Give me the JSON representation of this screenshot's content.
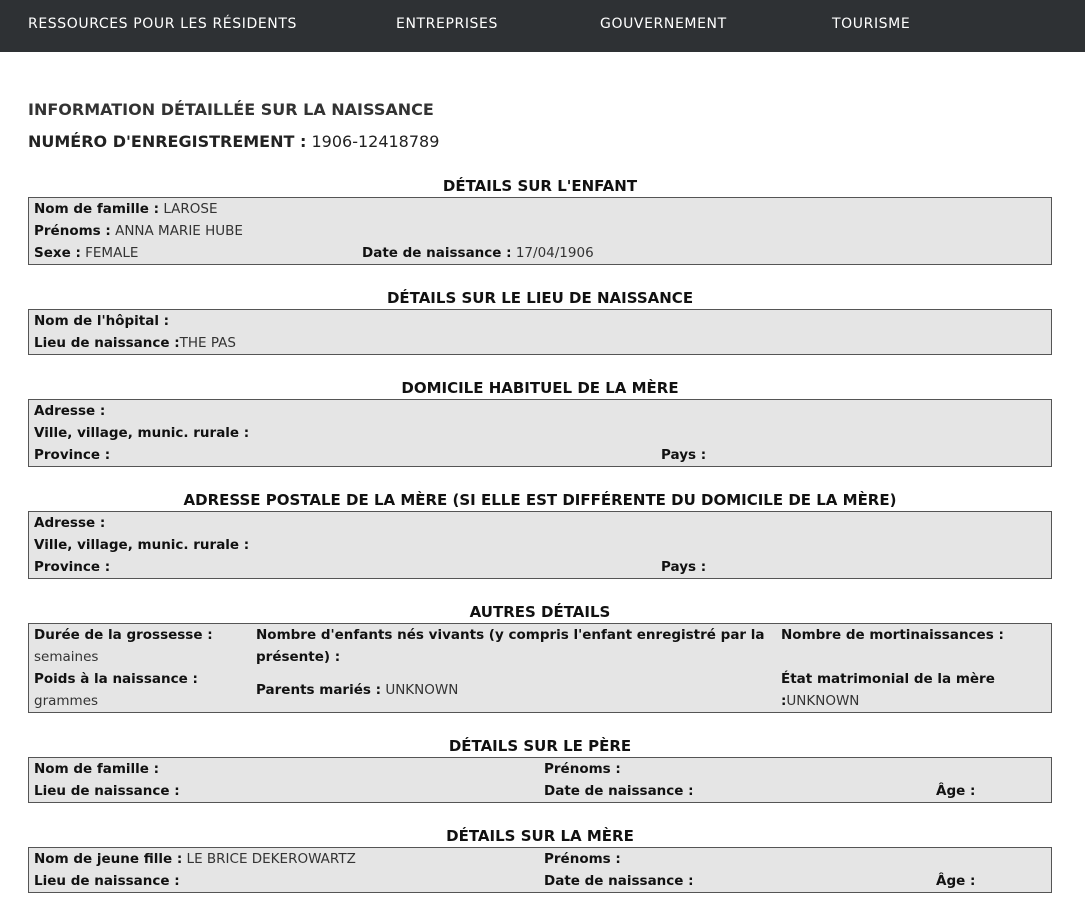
{
  "nav": [
    "RESSOURCES POUR LES RÉSIDENTS",
    "ENTREPRISES",
    "GOUVERNEMENT",
    "TOURISME"
  ],
  "page": {
    "title": "INFORMATION DÉTAILLÉE SUR LA NAISSANCE",
    "reg_label": "NUMÉRO D'ENREGISTREMENT :",
    "reg_value": "1906-12418789"
  },
  "child": {
    "heading": "DÉTAILS SUR L'ENFANT",
    "surname_label": "Nom de famille :",
    "surname": "LAROSE",
    "given_label": "Prénoms :",
    "given": "ANNA MARIE HUBE",
    "sex_label": "Sexe :",
    "sex": "FEMALE",
    "dob_label": "Date de naissance :",
    "dob": "17/04/1906"
  },
  "birthplace": {
    "heading": "DÉTAILS SUR LE LIEU DE NAISSANCE",
    "hospital_label": "Nom de l'hôpital :",
    "hospital": "",
    "place_label": "Lieu de naissance :",
    "place": "THE PAS"
  },
  "mother_home": {
    "heading": "DOMICILE HABITUEL DE LA MÈRE",
    "address_label": "Adresse :",
    "city_label": "Ville, village, munic. rurale :",
    "province_label": "Province :",
    "country_label": "Pays :"
  },
  "mother_postal": {
    "heading": "ADRESSE POSTALE DE LA MÈRE (SI ELLE EST DIFFÉRENTE DU DOMICILE DE LA MÈRE)",
    "address_label": "Adresse :",
    "city_label": "Ville, village, munic. rurale :",
    "province_label": "Province :",
    "country_label": "Pays :"
  },
  "other": {
    "heading": "AUTRES DÉTAILS",
    "pregnancy_label": "Durée de la grossesse :",
    "pregnancy_unit": "semaines",
    "weight_label": "Poids à la naissance :",
    "weight_unit": "grammes",
    "liveborn_label_1": "Nombre d'enfants nés vivants (y compris l'enfant enregistré par la",
    "liveborn_label_2": "présente) :",
    "married_label": "Parents mariés :",
    "married": "UNKNOWN",
    "stillbirth_label": "Nombre de mortinaissances :",
    "marital_label": "État matrimonial de la mère",
    "marital_colon": ":",
    "marital": "UNKNOWN"
  },
  "father": {
    "heading": "DÉTAILS SUR LE PÈRE",
    "surname_label": "Nom de famille :",
    "given_label": "Prénoms :",
    "place_label": "Lieu de naissance :",
    "dob_label": "Date de naissance :",
    "age_label": "Âge :"
  },
  "mother": {
    "heading": "DÉTAILS SUR LA MÈRE",
    "maiden_label": "Nom de jeune fille :",
    "maiden": "LE BRICE DEKEROWARTZ",
    "given_label": "Prénoms :",
    "place_label": "Lieu de naissance :",
    "dob_label": "Date de naissance :",
    "age_label": "Âge :"
  }
}
